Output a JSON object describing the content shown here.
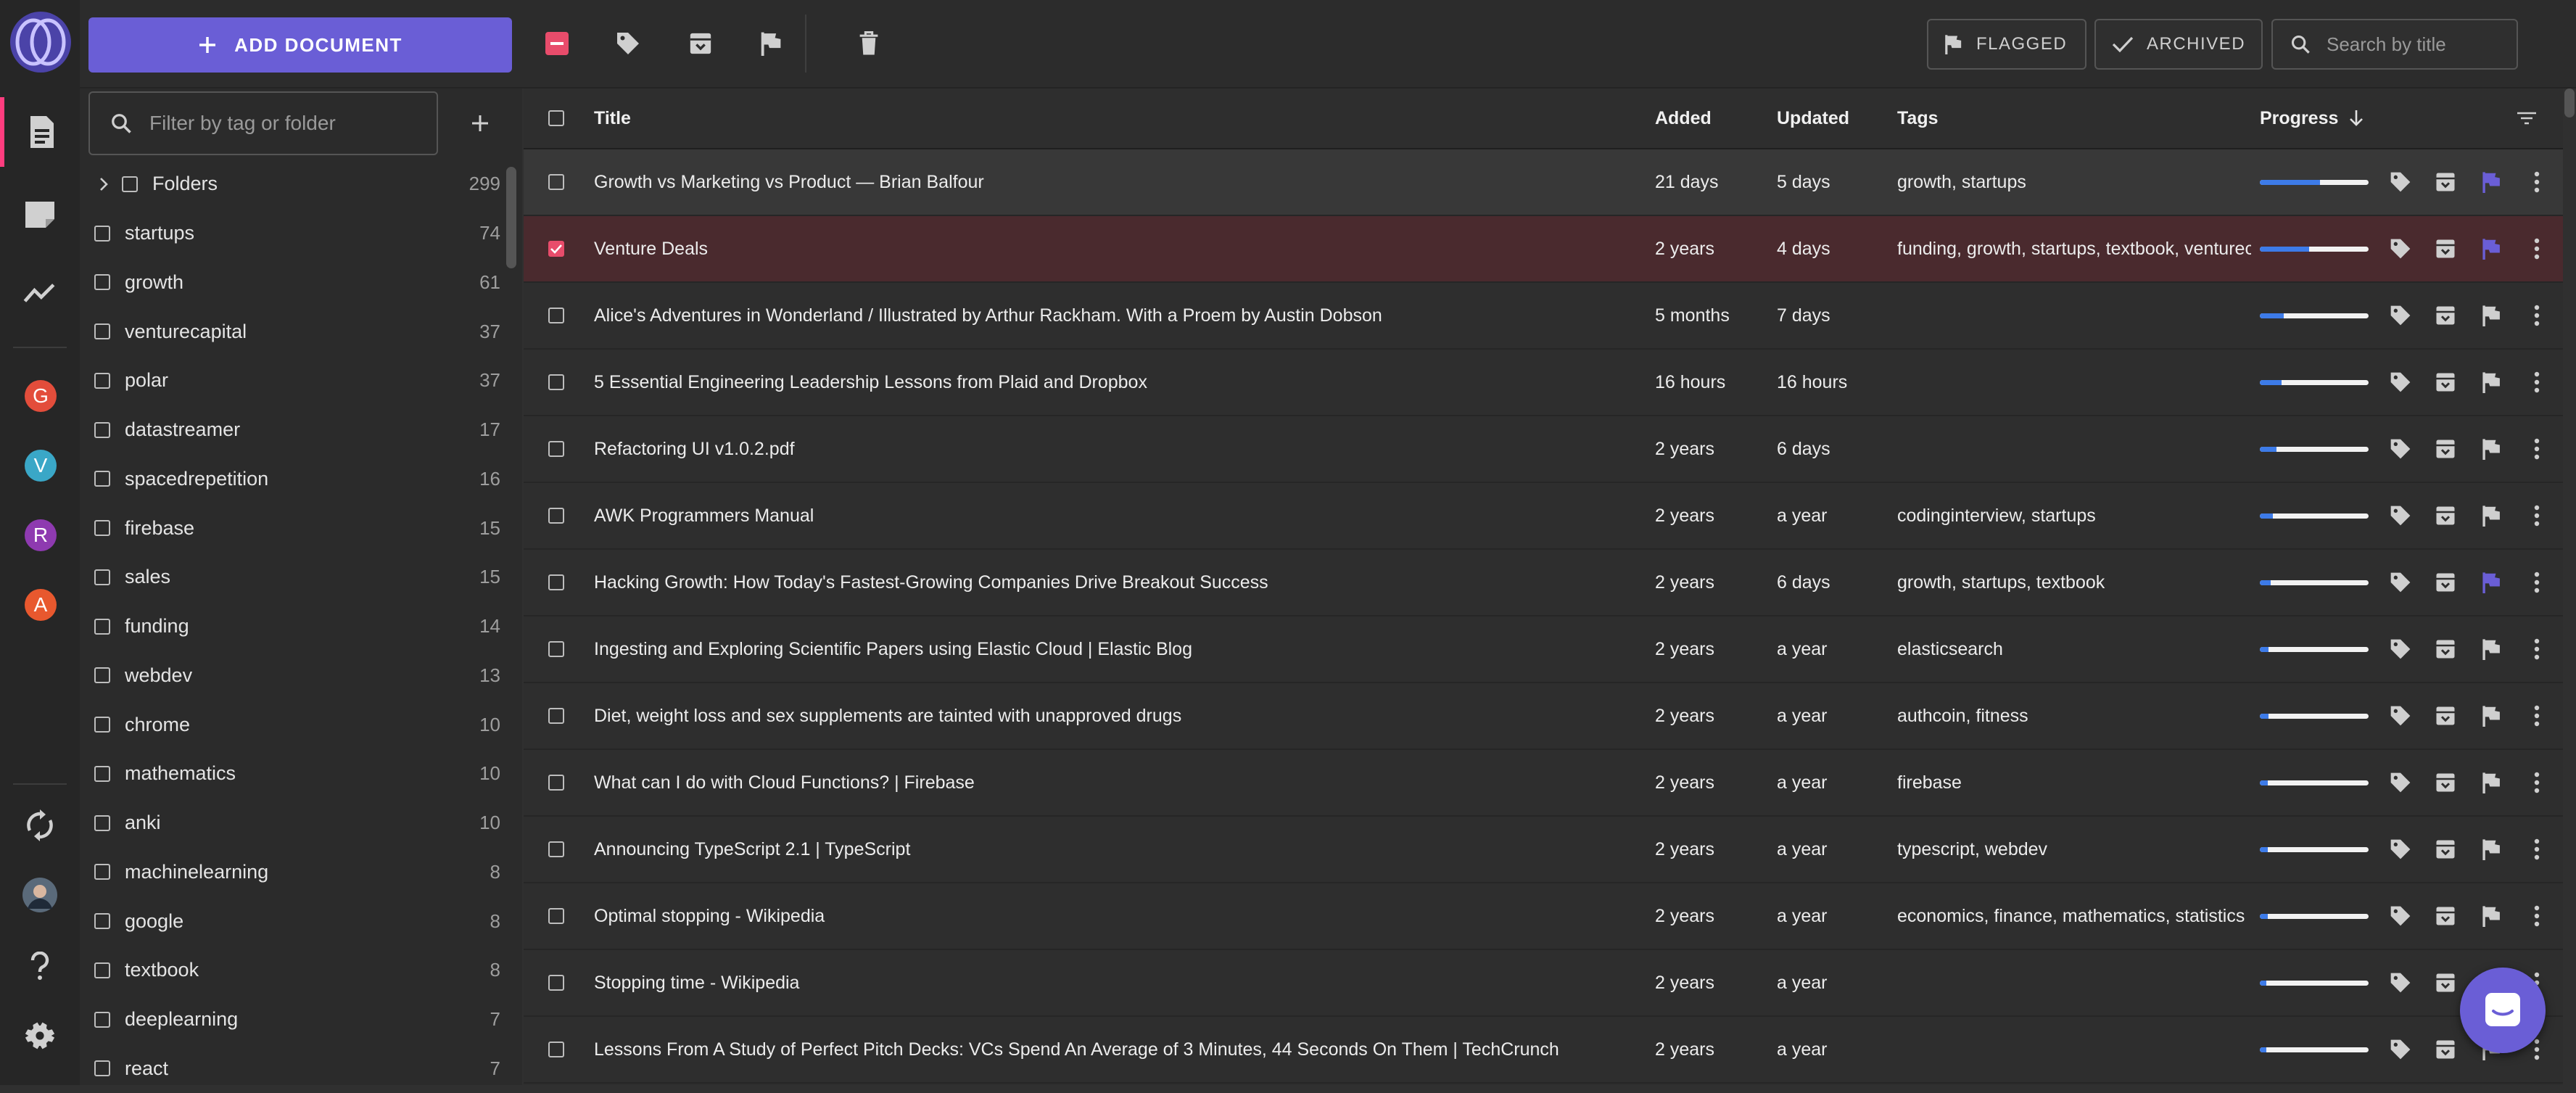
{
  "colors": {
    "accent": "#6a5ed6",
    "danger": "#e84c6b",
    "progress": "#3d7be8",
    "flag_active": "#6a5ed6"
  },
  "rail": {
    "avatars": [
      {
        "letter": "G",
        "color": "#e34d3b"
      },
      {
        "letter": "V",
        "color": "#3aa7c7"
      },
      {
        "letter": "R",
        "color": "#8e3ab0"
      },
      {
        "letter": "A",
        "color": "#e8582e"
      }
    ]
  },
  "toolbar": {
    "add_document": "ADD DOCUMENT",
    "flagged": "FLAGGED",
    "archived": "ARCHIVED",
    "search_placeholder": "Search by title"
  },
  "sidebar": {
    "filter_placeholder": "Filter by tag or folder",
    "folders": {
      "label": "Folders",
      "count": "299"
    },
    "tags": [
      {
        "name": "startups",
        "count": "74"
      },
      {
        "name": "growth",
        "count": "61"
      },
      {
        "name": "venturecapital",
        "count": "37"
      },
      {
        "name": "polar",
        "count": "37"
      },
      {
        "name": "datastreamer",
        "count": "17"
      },
      {
        "name": "spacedrepetition",
        "count": "16"
      },
      {
        "name": "firebase",
        "count": "15"
      },
      {
        "name": "sales",
        "count": "15"
      },
      {
        "name": "funding",
        "count": "14"
      },
      {
        "name": "webdev",
        "count": "13"
      },
      {
        "name": "chrome",
        "count": "10"
      },
      {
        "name": "mathematics",
        "count": "10"
      },
      {
        "name": "anki",
        "count": "10"
      },
      {
        "name": "machinelearning",
        "count": "8"
      },
      {
        "name": "google",
        "count": "8"
      },
      {
        "name": "textbook",
        "count": "8"
      },
      {
        "name": "deeplearning",
        "count": "7"
      },
      {
        "name": "react",
        "count": "7"
      }
    ]
  },
  "table": {
    "columns": {
      "title": "Title",
      "added": "Added",
      "updated": "Updated",
      "tags": "Tags",
      "progress": "Progress"
    },
    "rows": [
      {
        "title": "Growth vs Marketing vs Product — Brian Balfour",
        "added": "21 days",
        "updated": "5 days",
        "tags": "growth, startups",
        "progress": 0.55,
        "flagged": true,
        "checked": false,
        "state": "hover"
      },
      {
        "title": "Venture Deals",
        "added": "2 years",
        "updated": "4 days",
        "tags": "funding, growth, startups, textbook, venturec...",
        "progress": 0.45,
        "flagged": true,
        "checked": true,
        "state": "selected"
      },
      {
        "title": "Alice's Adventures in Wonderland / Illustrated by Arthur Rackham. With a Proem by Austin Dobson",
        "added": "5 months",
        "updated": "7 days",
        "tags": "",
        "progress": 0.22,
        "flagged": false,
        "checked": false,
        "state": ""
      },
      {
        "title": "5 Essential Engineering Leadership Lessons from Plaid and Dropbox",
        "added": "16 hours",
        "updated": "16 hours",
        "tags": "",
        "progress": 0.2,
        "flagged": false,
        "checked": false,
        "state": ""
      },
      {
        "title": "Refactoring UI v1.0.2.pdf",
        "added": "2 years",
        "updated": "6 days",
        "tags": "",
        "progress": 0.15,
        "flagged": false,
        "checked": false,
        "state": ""
      },
      {
        "title": "AWK Programmers Manual",
        "added": "2 years",
        "updated": "a year",
        "tags": "codinginterview, startups",
        "progress": 0.12,
        "flagged": false,
        "checked": false,
        "state": ""
      },
      {
        "title": "Hacking Growth: How Today's Fastest-Growing Companies Drive Breakout Success",
        "added": "2 years",
        "updated": "6 days",
        "tags": "growth, startups, textbook",
        "progress": 0.1,
        "flagged": true,
        "checked": false,
        "state": ""
      },
      {
        "title": "Ingesting and Exploring Scientific Papers using Elastic Cloud | Elastic Blog",
        "added": "2 years",
        "updated": "a year",
        "tags": "elasticsearch",
        "progress": 0.08,
        "flagged": false,
        "checked": false,
        "state": ""
      },
      {
        "title": "Diet, weight loss and sex supplements are tainted with unapproved drugs",
        "added": "2 years",
        "updated": "a year",
        "tags": "authcoin, fitness",
        "progress": 0.08,
        "flagged": false,
        "checked": false,
        "state": ""
      },
      {
        "title": "What can I do with Cloud Functions?  |  Firebase",
        "added": "2 years",
        "updated": "a year",
        "tags": "firebase",
        "progress": 0.07,
        "flagged": false,
        "checked": false,
        "state": ""
      },
      {
        "title": "Announcing TypeScript 2.1 | TypeScript",
        "added": "2 years",
        "updated": "a year",
        "tags": "typescript, webdev",
        "progress": 0.07,
        "flagged": false,
        "checked": false,
        "state": ""
      },
      {
        "title": "Optimal stopping - Wikipedia",
        "added": "2 years",
        "updated": "a year",
        "tags": "economics, finance, mathematics, statistics",
        "progress": 0.07,
        "flagged": false,
        "checked": false,
        "state": ""
      },
      {
        "title": "Stopping time - Wikipedia",
        "added": "2 years",
        "updated": "a year",
        "tags": "",
        "progress": 0.06,
        "flagged": false,
        "checked": false,
        "state": ""
      },
      {
        "title": "Lessons From A Study of Perfect Pitch Decks: VCs Spend An Average of 3 Minutes, 44 Seconds On Them | TechCrunch",
        "added": "2 years",
        "updated": "a year",
        "tags": "",
        "progress": 0.06,
        "flagged": false,
        "checked": false,
        "state": ""
      }
    ]
  }
}
